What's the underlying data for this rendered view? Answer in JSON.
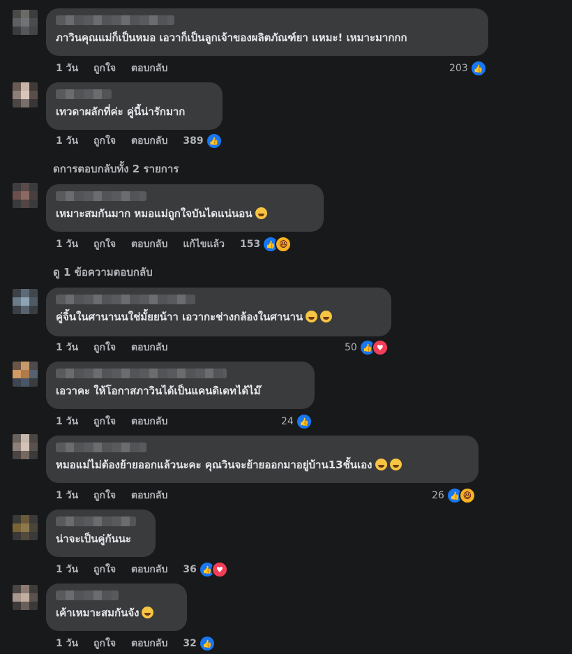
{
  "reply_labels": {
    "time": "1 วัน",
    "like": "ถูกใจ",
    "reply": "ตอบกลับ"
  },
  "comments": [
    {
      "text": "ภาวินคุณแม่ก็เป็นหมอ เอวาก็เป็นลูกเจ้าของผลิตภัณฑ์ยา แหมะ! เหมาะมากกก",
      "count": "203",
      "reactions": [
        "like"
      ]
    },
    {
      "text": "เทวดาผลักที่ค่ะ คู่นี้น่ารักมาก",
      "count": "389",
      "reactions": [
        "like"
      ]
    },
    {
      "text": "เหมาะสมกันมาก หมอแม่ถูกใจบันไดแน่นอน",
      "emoji": "grinning-face",
      "edited": "แก้ไขแล้ว",
      "count": "153",
      "reactions": [
        "like",
        "haha"
      ]
    },
    {
      "text": "คู่จิ้นในศานานนใช่มั้ยยน้าา เอวากะช่างกล้องในศานาน",
      "emoji": "grinning-face",
      "count": "50",
      "reactions": [
        "like",
        "love"
      ]
    },
    {
      "text": "เอวาคะ ให้โอกาสภาวินได้เป็นแคนดิเดทได้ไม๊",
      "count": "24",
      "reactions": [
        "like"
      ]
    },
    {
      "text": "หมอแม่ไม่ต้องย้ายออกแล้วนะคะ คุณวินจะย้ายออกมาอยู่บ้าน13ชั้นเอง",
      "emoji": "laughing-face",
      "count": "26",
      "reactions": [
        "like",
        "haha"
      ]
    },
    {
      "text": "น่าจะเป็นคู่กันนะ",
      "count": "36",
      "reactions": [
        "like",
        "love"
      ]
    },
    {
      "text": "เค้าเหมาะสมกันจัง",
      "emoji": "smiling-face",
      "count": "32",
      "reactions": [
        "like"
      ]
    }
  ],
  "view_replies": [
    "ดการตอบกลับทั้ง 2 รายการ",
    "ดู 1 ข้อความตอบกลับ"
  ],
  "colors": {
    "background": "#18191a",
    "bubble": "#3a3b3c",
    "like": "#1877f2",
    "love": "#f33e58",
    "haha": "#f7b125"
  }
}
